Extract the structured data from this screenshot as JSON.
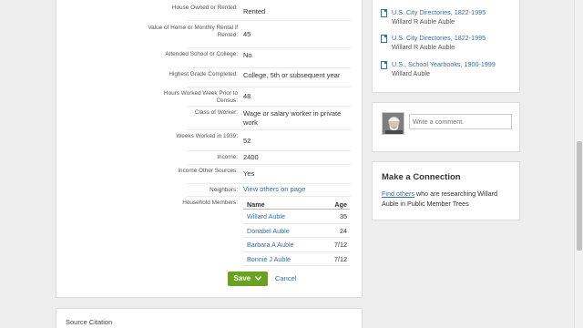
{
  "facts": [
    {
      "label": "House Owned or Rented:",
      "value": "Rented"
    },
    {
      "label": "Value of Home or Monthly Rental if Rented:",
      "value": "45"
    },
    {
      "label": "Attended School or College:",
      "value": "No"
    },
    {
      "label": "Highest Grade Completed:",
      "value": "College, 5th or subsequent year"
    },
    {
      "label": "Hours Worked Week Prior to Census:",
      "value": "48"
    },
    {
      "label": "Class of Worker:",
      "value": "Wage or salary worker in private work"
    },
    {
      "label": "Weeks Worked in 1939:",
      "value": "52"
    },
    {
      "label": "Income:",
      "value": "2400"
    },
    {
      "label": "Income Other Sources:",
      "value": "Yes"
    },
    {
      "label": "Neighbors:",
      "value": "View others on page"
    },
    {
      "label": "Household Members:",
      "value": ""
    }
  ],
  "household": {
    "col_name": "Name",
    "col_age": "Age",
    "members": [
      {
        "name": "Willard Auble",
        "age": "35"
      },
      {
        "name": "Donabel Auble",
        "age": "24"
      },
      {
        "name": "Barbara A Auble",
        "age": "7/12"
      },
      {
        "name": "Bonnie J Auble",
        "age": "7/12"
      }
    ]
  },
  "actions": {
    "save_label": "Save",
    "cancel_label": "Cancel"
  },
  "source_citation": {
    "title": "Source Citation"
  },
  "related_records": [
    {
      "title": "U.S. City Directories, 1822-1995",
      "subtitle": "Willard R Auble Auble"
    },
    {
      "title": "U.S. City Directories, 1822-1995",
      "subtitle": "Willard R Auble Auble"
    },
    {
      "title": "U.S., School Yearbooks, 1900-1999",
      "subtitle": "Willard Auble"
    }
  ],
  "comment": {
    "placeholder": "Write a comment."
  },
  "connection": {
    "title": "Make a Connection",
    "link_text": "Find others",
    "text": " who are researching Willard Auble in Public Member Trees"
  },
  "colors": {
    "accent": "#6aa121",
    "link": "#3b6d9e"
  }
}
